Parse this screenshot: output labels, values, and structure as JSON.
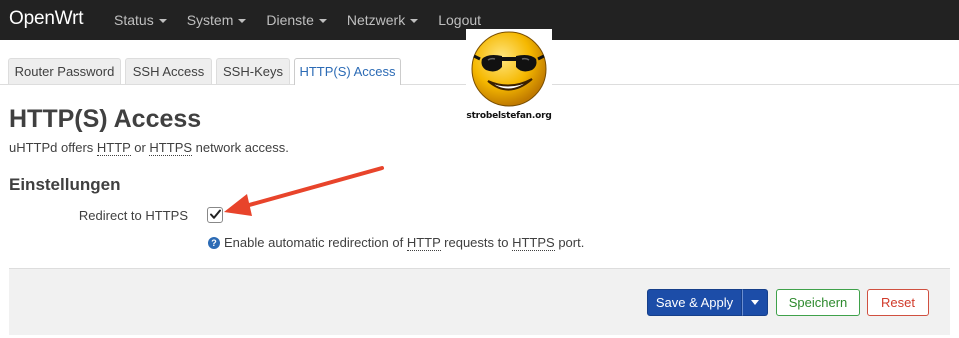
{
  "header": {
    "brand": "OpenWrt",
    "menu": [
      {
        "label": "Status",
        "dropdown": true
      },
      {
        "label": "System",
        "dropdown": true
      },
      {
        "label": "Dienste",
        "dropdown": true
      },
      {
        "label": "Netzwerk",
        "dropdown": true
      },
      {
        "label": "Logout",
        "dropdown": false
      }
    ]
  },
  "tabs": [
    {
      "label": "Router Password",
      "active": false
    },
    {
      "label": "SSH Access",
      "active": false
    },
    {
      "label": "SSH-Keys",
      "active": false
    },
    {
      "label": "HTTP(S) Access",
      "active": true
    }
  ],
  "watermark": {
    "text": "strobelstefan.org"
  },
  "page": {
    "title": "HTTP(S) Access",
    "description": {
      "pre": "uHTTPd offers ",
      "abbr1": "HTTP",
      "mid": " or ",
      "abbr2": "HTTPS",
      "post": " network access."
    },
    "section_title": "Einstellungen",
    "field": {
      "label": "Redirect to HTTPS",
      "checked": true,
      "help": {
        "icon": "?",
        "pre": "Enable automatic redirection of ",
        "abbr1": "HTTP",
        "mid": " requests to ",
        "abbr2": "HTTPS",
        "post": " port."
      }
    }
  },
  "actions": {
    "save_apply": "Save & Apply",
    "save": "Speichern",
    "reset": "Reset"
  },
  "colors": {
    "topbar": "#222222",
    "primary_button": "#1c4da8",
    "save_button": "#3fa14a",
    "reset_button": "#d05040",
    "annotation_arrow": "#e8442b",
    "active_tab_text": "#2c6bb5"
  }
}
